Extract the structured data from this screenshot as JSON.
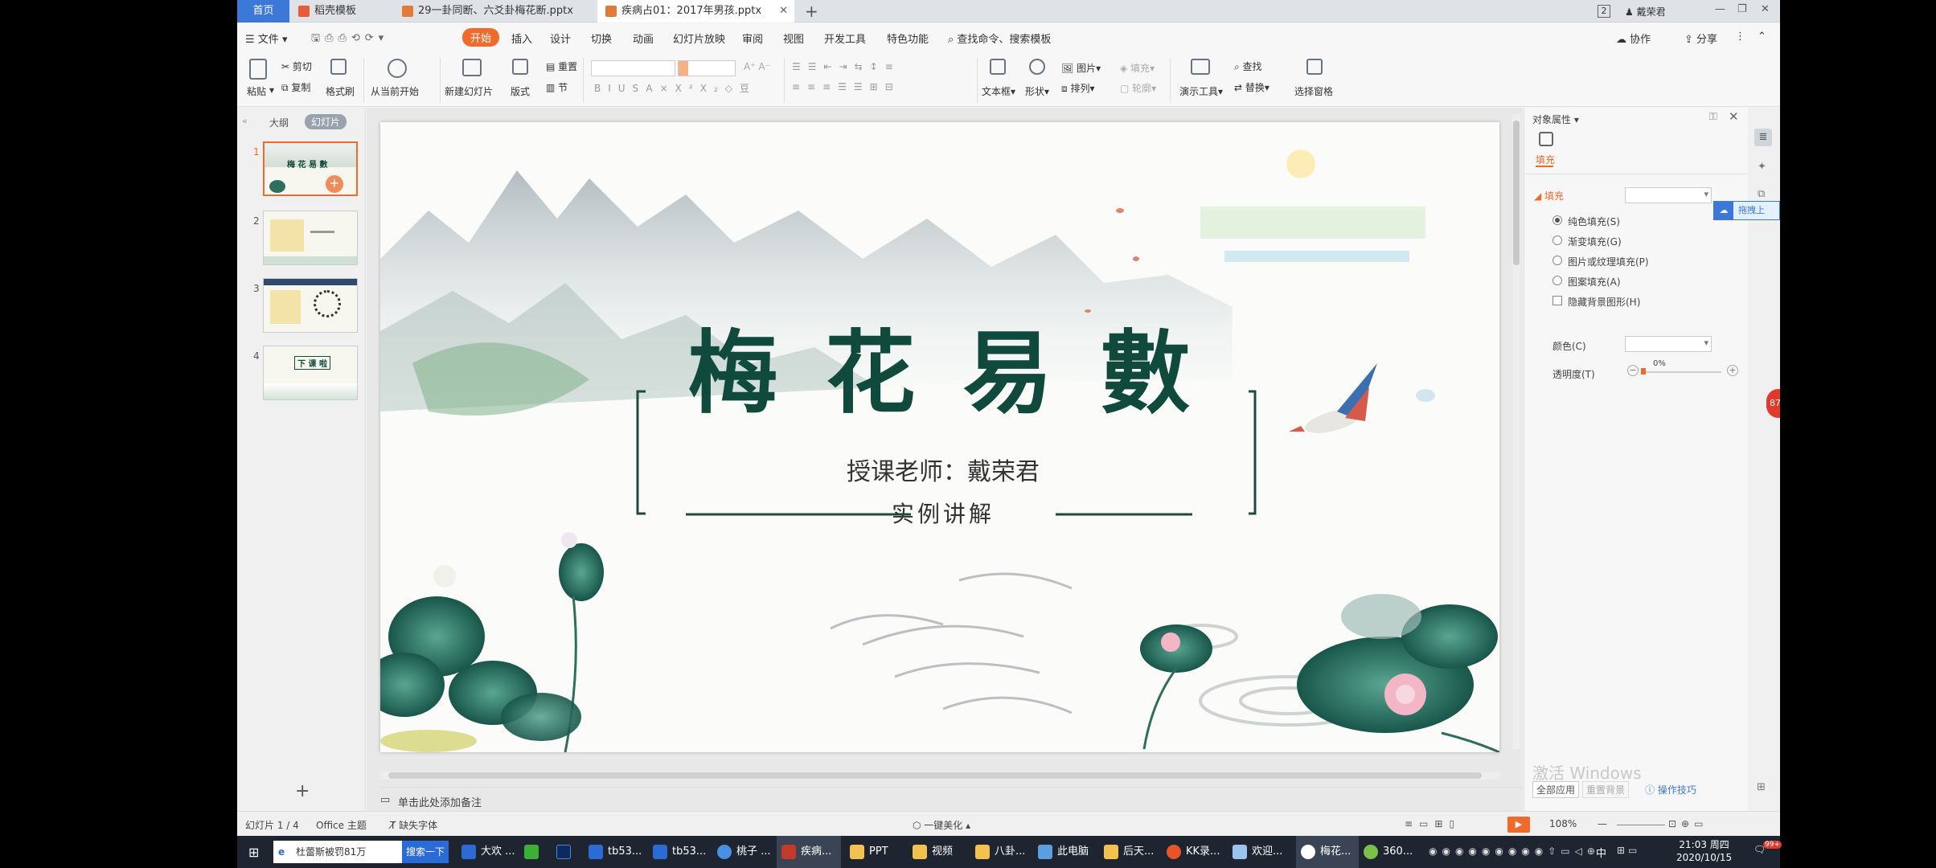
{
  "tabs": [
    {
      "label": "首页"
    },
    {
      "label": "稻壳模板"
    },
    {
      "label": "29一卦同断、六爻卦梅花断.pptx"
    },
    {
      "label": "疾病占01：2017年男孩.pptx"
    }
  ],
  "titlebar": {
    "badge": "2",
    "user": "戴荣君"
  },
  "menu": {
    "file": "文件",
    "items": [
      "开始",
      "插入",
      "设计",
      "切换",
      "动画",
      "幻灯片放映",
      "审阅",
      "视图",
      "开发工具",
      "特色功能"
    ],
    "search": "查找命令、搜索模板",
    "collab": "协作",
    "share": "分享"
  },
  "ribbon": {
    "paste": "粘贴",
    "cut": "剪切",
    "copy": "复制",
    "format_painter": "格式刷",
    "from_current": "从当前开始",
    "new_slide": "新建幻灯片",
    "layout": "版式",
    "section": "节",
    "reset": "重置",
    "textbox": "文本框",
    "shape": "形状",
    "picture": "图片",
    "fill": "填充",
    "arrange": "排列",
    "outline": "轮廓",
    "present_tools": "演示工具",
    "find": "查找",
    "replace": "替换",
    "select_pane": "选择窗格"
  },
  "thumbpanel": {
    "tab_outline": "大纲",
    "tab_slides": "幻灯片",
    "slides": [
      {
        "num": "1",
        "text": "梅 花 易 數"
      },
      {
        "num": "2",
        "text": ""
      },
      {
        "num": "3",
        "text": ""
      },
      {
        "num": "4",
        "text": "下 课 啦"
      }
    ],
    "add": "+"
  },
  "slide": {
    "title": "梅 花 易 數",
    "teacher": "授课老师：戴荣君",
    "subtitle": "实例讲解"
  },
  "notes_placeholder": "单击此处添加备注",
  "props": {
    "title": "对象属性",
    "tab_fill": "填充",
    "section_fill": "填充",
    "options": [
      "纯色填充(S)",
      "渐变填充(G)",
      "图片或纹理填充(P)",
      "图案填充(A)"
    ],
    "hide_bg": "隐藏背景图形(H)",
    "color_label": "颜色(C)",
    "transparency_label": "透明度(T)",
    "transparency_value": "0%",
    "apply_all": "全部应用",
    "reset_bg": "重置背景",
    "tips": "操作技巧",
    "cloud_tag": "拖拽上",
    "badge": "87"
  },
  "watermark": {
    "line1": "激活 Windows"
  },
  "status": {
    "slide_pos": "幻灯片 1 / 4",
    "theme": "Office 主题",
    "missing_font": "缺失字体",
    "beautify": "一键美化",
    "zoom": "108%"
  },
  "taskbar": {
    "search_text": "杜蕾斯被罚81万",
    "search_btn": "搜索一下",
    "items": [
      "大欢 ...",
      "",
      "",
      "tb53...",
      "tb53...",
      "桃子 ...",
      "疾病...",
      "PPT",
      "视频",
      "八卦...",
      "此电脑",
      "后天...",
      "KK录...",
      "欢迎...",
      "梅花...",
      "360..."
    ],
    "time": "21:03 周四",
    "date": "2020/10/15",
    "ime": "中",
    "notif": "99+"
  },
  "colors": {
    "accent": "#f06a2c",
    "home_tab": "#3b78d8",
    "title_green": "#0f4a3c"
  }
}
